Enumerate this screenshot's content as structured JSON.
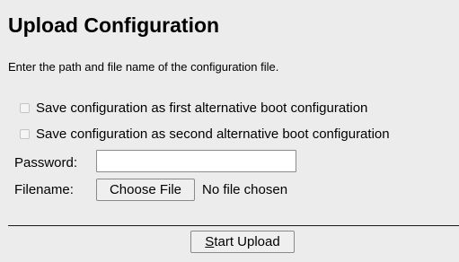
{
  "page": {
    "title": "Upload Configuration",
    "intro": "Enter the path and file name of the configuration file."
  },
  "options": [
    {
      "label": "Save configuration as first alternative boot configuration",
      "checked": false
    },
    {
      "label": "Save configuration as second alternative boot configuration",
      "checked": false
    }
  ],
  "form": {
    "password_label": "Password:",
    "password_value": "",
    "filename_label": "Filename:",
    "choose_file_label": "Choose File",
    "file_status": "No file chosen"
  },
  "actions": {
    "start_upload_accesskey": "S",
    "start_upload_rest": "tart Upload"
  }
}
